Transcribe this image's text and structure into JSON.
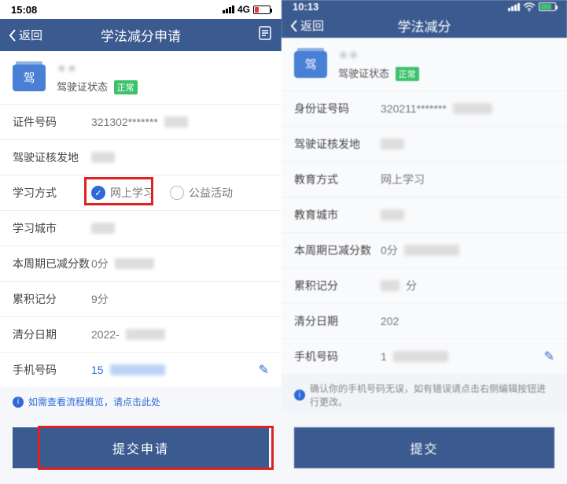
{
  "left": {
    "status": {
      "time": "15:08",
      "net": "4G"
    },
    "nav": {
      "back": "返回",
      "title": "学法减分申请"
    },
    "profile": {
      "badge": "驾",
      "status_label": "驾驶证状态",
      "status_value": "正常"
    },
    "rows": {
      "id_label": "证件号码",
      "id_value": "321302*******",
      "issue_label": "驾驶证核发地",
      "method_label": "学习方式",
      "method_online": "网上学习",
      "method_public": "公益活动",
      "city_label": "学习城市",
      "cycle_label": "本周期已减分数",
      "cycle_value": "0分",
      "accum_label": "累积记分",
      "accum_value": "9分",
      "clear_label": "清分日期",
      "clear_value": "2022-",
      "phone_label": "手机号码",
      "phone_value": "15"
    },
    "hint": "如需查看流程概览，请点击此处",
    "submit": "提交申请"
  },
  "right": {
    "status": {
      "time": "10:13"
    },
    "nav": {
      "back": "返回",
      "title": "学法减分"
    },
    "profile": {
      "badge": "驾",
      "status_label": "驾驶证状态",
      "status_value": "正常"
    },
    "rows": {
      "id_label": "身份证号码",
      "id_value": "320211*******",
      "issue_label": "驾驶证核发地",
      "method_label": "教育方式",
      "method_value": "网上学习",
      "city_label": "教育城市",
      "cycle_label": "本周期已减分数",
      "cycle_value": "0分",
      "accum_label": "累积记分",
      "accum_value": "分",
      "clear_label": "清分日期",
      "clear_value": "202",
      "phone_label": "手机号码",
      "phone_value": "1"
    },
    "hint": "确认你的手机号码无误，如有错误请点击右侧编辑按钮进行更改。",
    "submit": "提交"
  }
}
